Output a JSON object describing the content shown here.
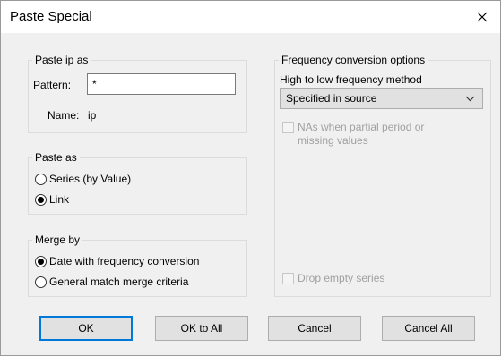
{
  "window": {
    "title": "Paste Special"
  },
  "paste_ip_as": {
    "legend": "Paste ip as",
    "pattern_label": "Pattern:",
    "pattern_value": "*",
    "name_label": "Name:",
    "name_value": "ip"
  },
  "paste_as": {
    "legend": "Paste as",
    "options": [
      {
        "label": "Series (by Value)",
        "selected": false
      },
      {
        "label": "Link",
        "selected": true
      }
    ]
  },
  "merge_by": {
    "legend": "Merge by",
    "options": [
      {
        "label": "Date with frequency conversion",
        "selected": true
      },
      {
        "label": "General match merge criteria",
        "selected": false
      }
    ]
  },
  "frequency": {
    "legend": "Frequency conversion options",
    "method_label": "High to low frequency method",
    "method_value": "Specified in source",
    "nas_line1": "NAs when partial period or",
    "nas_line2": "missing values",
    "drop_empty": "Drop empty series"
  },
  "buttons": {
    "ok": "OK",
    "ok_all": "OK to All",
    "cancel": "Cancel",
    "cancel_all": "Cancel All"
  }
}
